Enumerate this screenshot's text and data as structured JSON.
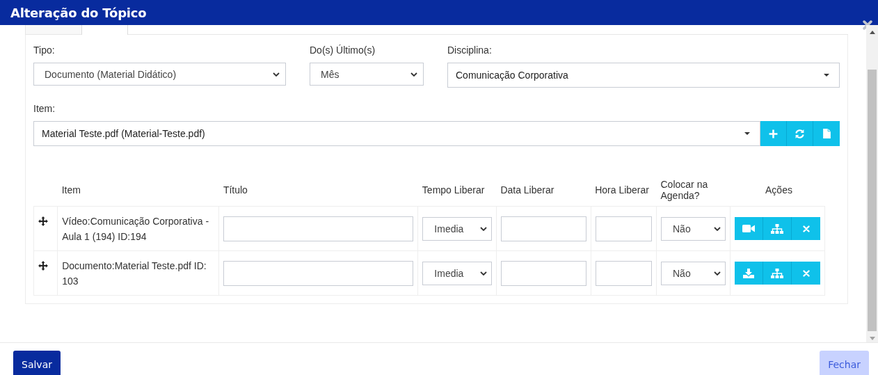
{
  "window": {
    "title": "Alteração do Tópico"
  },
  "tabs": [
    {
      "selected": false
    },
    {
      "selected": true
    }
  ],
  "filters": [
    {
      "label": "Tipo:",
      "value": "Documento (Material Didático)",
      "kind": "native"
    },
    {
      "label": "Do(s) Último(s)",
      "value": "Mês",
      "kind": "native"
    },
    {
      "label": "Disciplina:",
      "value": "Comunicação Corporativa",
      "kind": "search"
    }
  ],
  "item_picker": {
    "label": "Item:",
    "value": "Material Teste.pdf (Material-Teste.pdf)",
    "buttons": [
      {
        "kind": "add"
      },
      {
        "kind": "refresh"
      },
      {
        "kind": "file"
      }
    ]
  },
  "table": {
    "columns": [
      "Item",
      "Título",
      "Tempo Liberar",
      "Data Liberar",
      "Hora Liberar",
      "Colocar na Agenda?",
      "Ações"
    ],
    "rows": [
      {
        "item": "Vídeo:Comunicação Corporativa - Aula 1 (194) ID:194",
        "tempo": "Imedia",
        "agenda": "Não",
        "actions": [
          {
            "kind": "video"
          },
          {
            "kind": "sitemap"
          },
          {
            "kind": "delete"
          }
        ]
      },
      {
        "item": "Documento:Material Teste.pdf ID: 103",
        "tempo": "Imedia",
        "agenda": "Não",
        "actions": [
          {
            "kind": "download"
          },
          {
            "kind": "sitemap"
          },
          {
            "kind": "delete"
          }
        ]
      }
    ]
  },
  "footer": {
    "buttons": [
      {
        "label": "Salvar",
        "kind": "primary"
      },
      {
        "label": "Fechar",
        "kind": "light"
      }
    ]
  }
}
